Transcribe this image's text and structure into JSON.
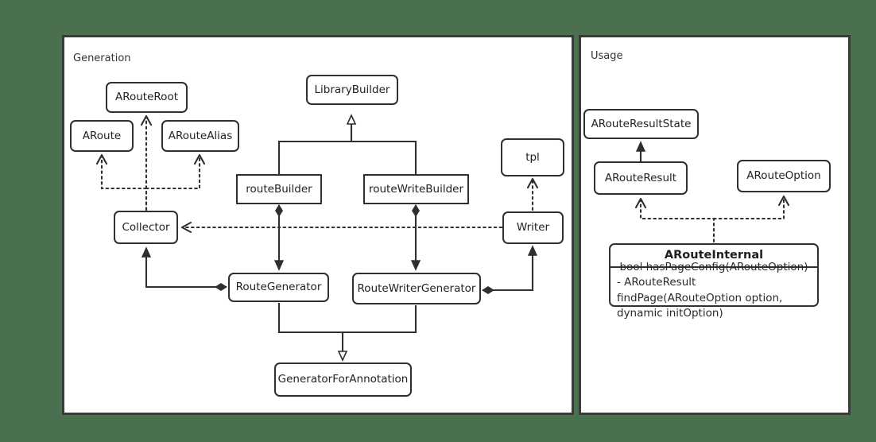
{
  "diagram": {
    "background_color": "#4a7050",
    "panels": [
      {
        "id": "generation",
        "title": "Generation"
      },
      {
        "id": "usage",
        "title": "Usage"
      }
    ]
  },
  "generation": {
    "nodes": {
      "aroute_root": "ARouteRoot",
      "aroute": "ARoute",
      "aroute_alias": "ARouteAlias",
      "library_builder": "LibraryBuilder",
      "route_builder": "routeBuilder",
      "route_write_builder": "routeWriteBuilder",
      "tpl": "tpl",
      "collector": "Collector",
      "writer": "Writer",
      "route_generator": "RouteGenerator",
      "route_writer_generator": "RouteWriterGenerator",
      "generator_for_annotation": "GeneratorForAnnotation"
    }
  },
  "usage": {
    "nodes": {
      "aroute_result_state": "ARouteResultState",
      "aroute_result": "ARouteResult",
      "aroute_option": "ARouteOption"
    },
    "aroute_internal": {
      "title": "ARouteInternal",
      "attribute": "bool hasPageConfig(ARouteOption)",
      "operation_line_1": "- ARouteResult",
      "operation_line_2": "findPage(ARouteOption option,",
      "operation_line_3": "dynamic initOption)"
    }
  },
  "edges": {
    "inheritance": [
      {
        "from": "routeBuilder",
        "to": "LibraryBuilder"
      },
      {
        "from": "routeWriteBuilder",
        "to": "LibraryBuilder"
      },
      {
        "from": "RouteGenerator",
        "to": "GeneratorForAnnotation"
      },
      {
        "from": "RouteWriterGenerator",
        "to": "GeneratorForAnnotation"
      },
      {
        "from": "ARouteResult",
        "to": "ARouteResultState"
      }
    ],
    "dependency": [
      {
        "from": "Collector",
        "to": "ARoute"
      },
      {
        "from": "Collector",
        "to": "ARouteRoot"
      },
      {
        "from": "Collector",
        "to": "ARouteAlias"
      },
      {
        "from": "Writer",
        "to": "Collector"
      },
      {
        "from": "Writer",
        "to": "tpl"
      },
      {
        "from": "ARouteInternal",
        "to": "ARouteResult"
      },
      {
        "from": "ARouteInternal",
        "to": "ARouteOption"
      }
    ],
    "composition": [
      {
        "whole": "routeBuilder",
        "part": "RouteGenerator"
      },
      {
        "whole": "routeWriteBuilder",
        "part": "RouteWriterGenerator"
      },
      {
        "whole": "RouteGenerator",
        "part": "Collector"
      },
      {
        "whole": "RouteWriterGenerator",
        "part": "Writer"
      }
    ]
  }
}
